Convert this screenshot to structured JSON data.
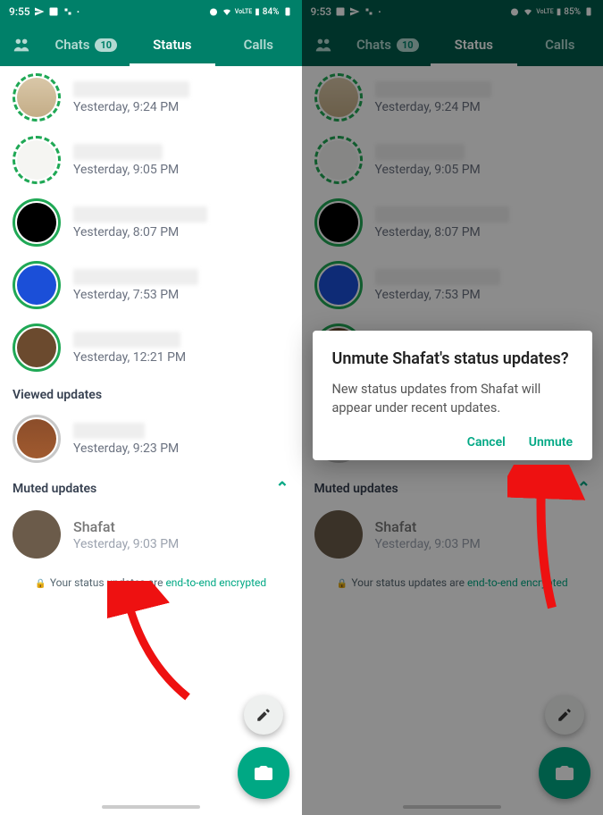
{
  "left": {
    "statusbar": {
      "time": "9:55",
      "battery": "84%",
      "net": "VoLTE"
    },
    "tabs": {
      "chats": "Chats",
      "chats_badge": "10",
      "status": "Status",
      "calls": "Calls"
    },
    "updates": [
      {
        "time": "Yesterday, 9:24 PM",
        "ring": "dashed",
        "avatar": "bag"
      },
      {
        "time": "Yesterday, 9:05 PM",
        "ring": "dashed",
        "avatar": "text"
      },
      {
        "time": "Yesterday, 8:07 PM",
        "ring": "solid",
        "avatar": "black"
      },
      {
        "time": "Yesterday, 7:53 PM",
        "ring": "solid",
        "avatar": "blue"
      },
      {
        "time": "Yesterday, 12:21 PM",
        "ring": "solid",
        "avatar": "brown"
      }
    ],
    "viewed_header": "Viewed updates",
    "viewed": [
      {
        "time": "Yesterday, 9:23 PM",
        "ring": "grey",
        "avatar": "m1"
      }
    ],
    "muted_header": "Muted updates",
    "muted": [
      {
        "name": "Shafat",
        "time": "Yesterday, 9:03 PM",
        "ring": "none",
        "avatar": "m2"
      }
    ],
    "e2e_prefix": "Your status updates are ",
    "e2e_link": "end-to-end encrypted"
  },
  "right": {
    "statusbar": {
      "time": "9:53",
      "battery": "85%",
      "net": "VoLTE"
    },
    "dialog": {
      "title": "Unmute Shafat's status updates?",
      "body": "New status updates from Shafat will appear under recent updates.",
      "cancel": "Cancel",
      "confirm": "Unmute"
    }
  },
  "colors": {
    "brand": "#008069",
    "accent": "#00a884",
    "arrow": "#e11"
  }
}
